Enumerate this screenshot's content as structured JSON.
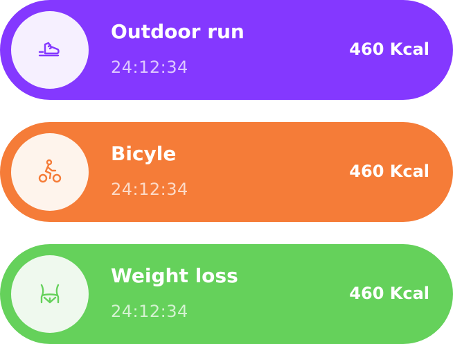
{
  "activities": [
    {
      "title": "Outdoor run",
      "time": "24:12:34",
      "kcal": "460 Kcal",
      "icon": "running-shoe-icon",
      "color": "#8438FF",
      "icon_bg": "#F6F0FF"
    },
    {
      "title": "Bicyle",
      "time": "24:12:34",
      "kcal": "460 Kcal",
      "icon": "bicycle-rider-icon",
      "color": "#F57C38",
      "icon_bg": "#FEF4EC"
    },
    {
      "title": "Weight loss",
      "time": "24:12:34",
      "kcal": "460 Kcal",
      "icon": "waist-icon",
      "color": "#65D15B",
      "icon_bg": "#EFF9EE"
    }
  ]
}
